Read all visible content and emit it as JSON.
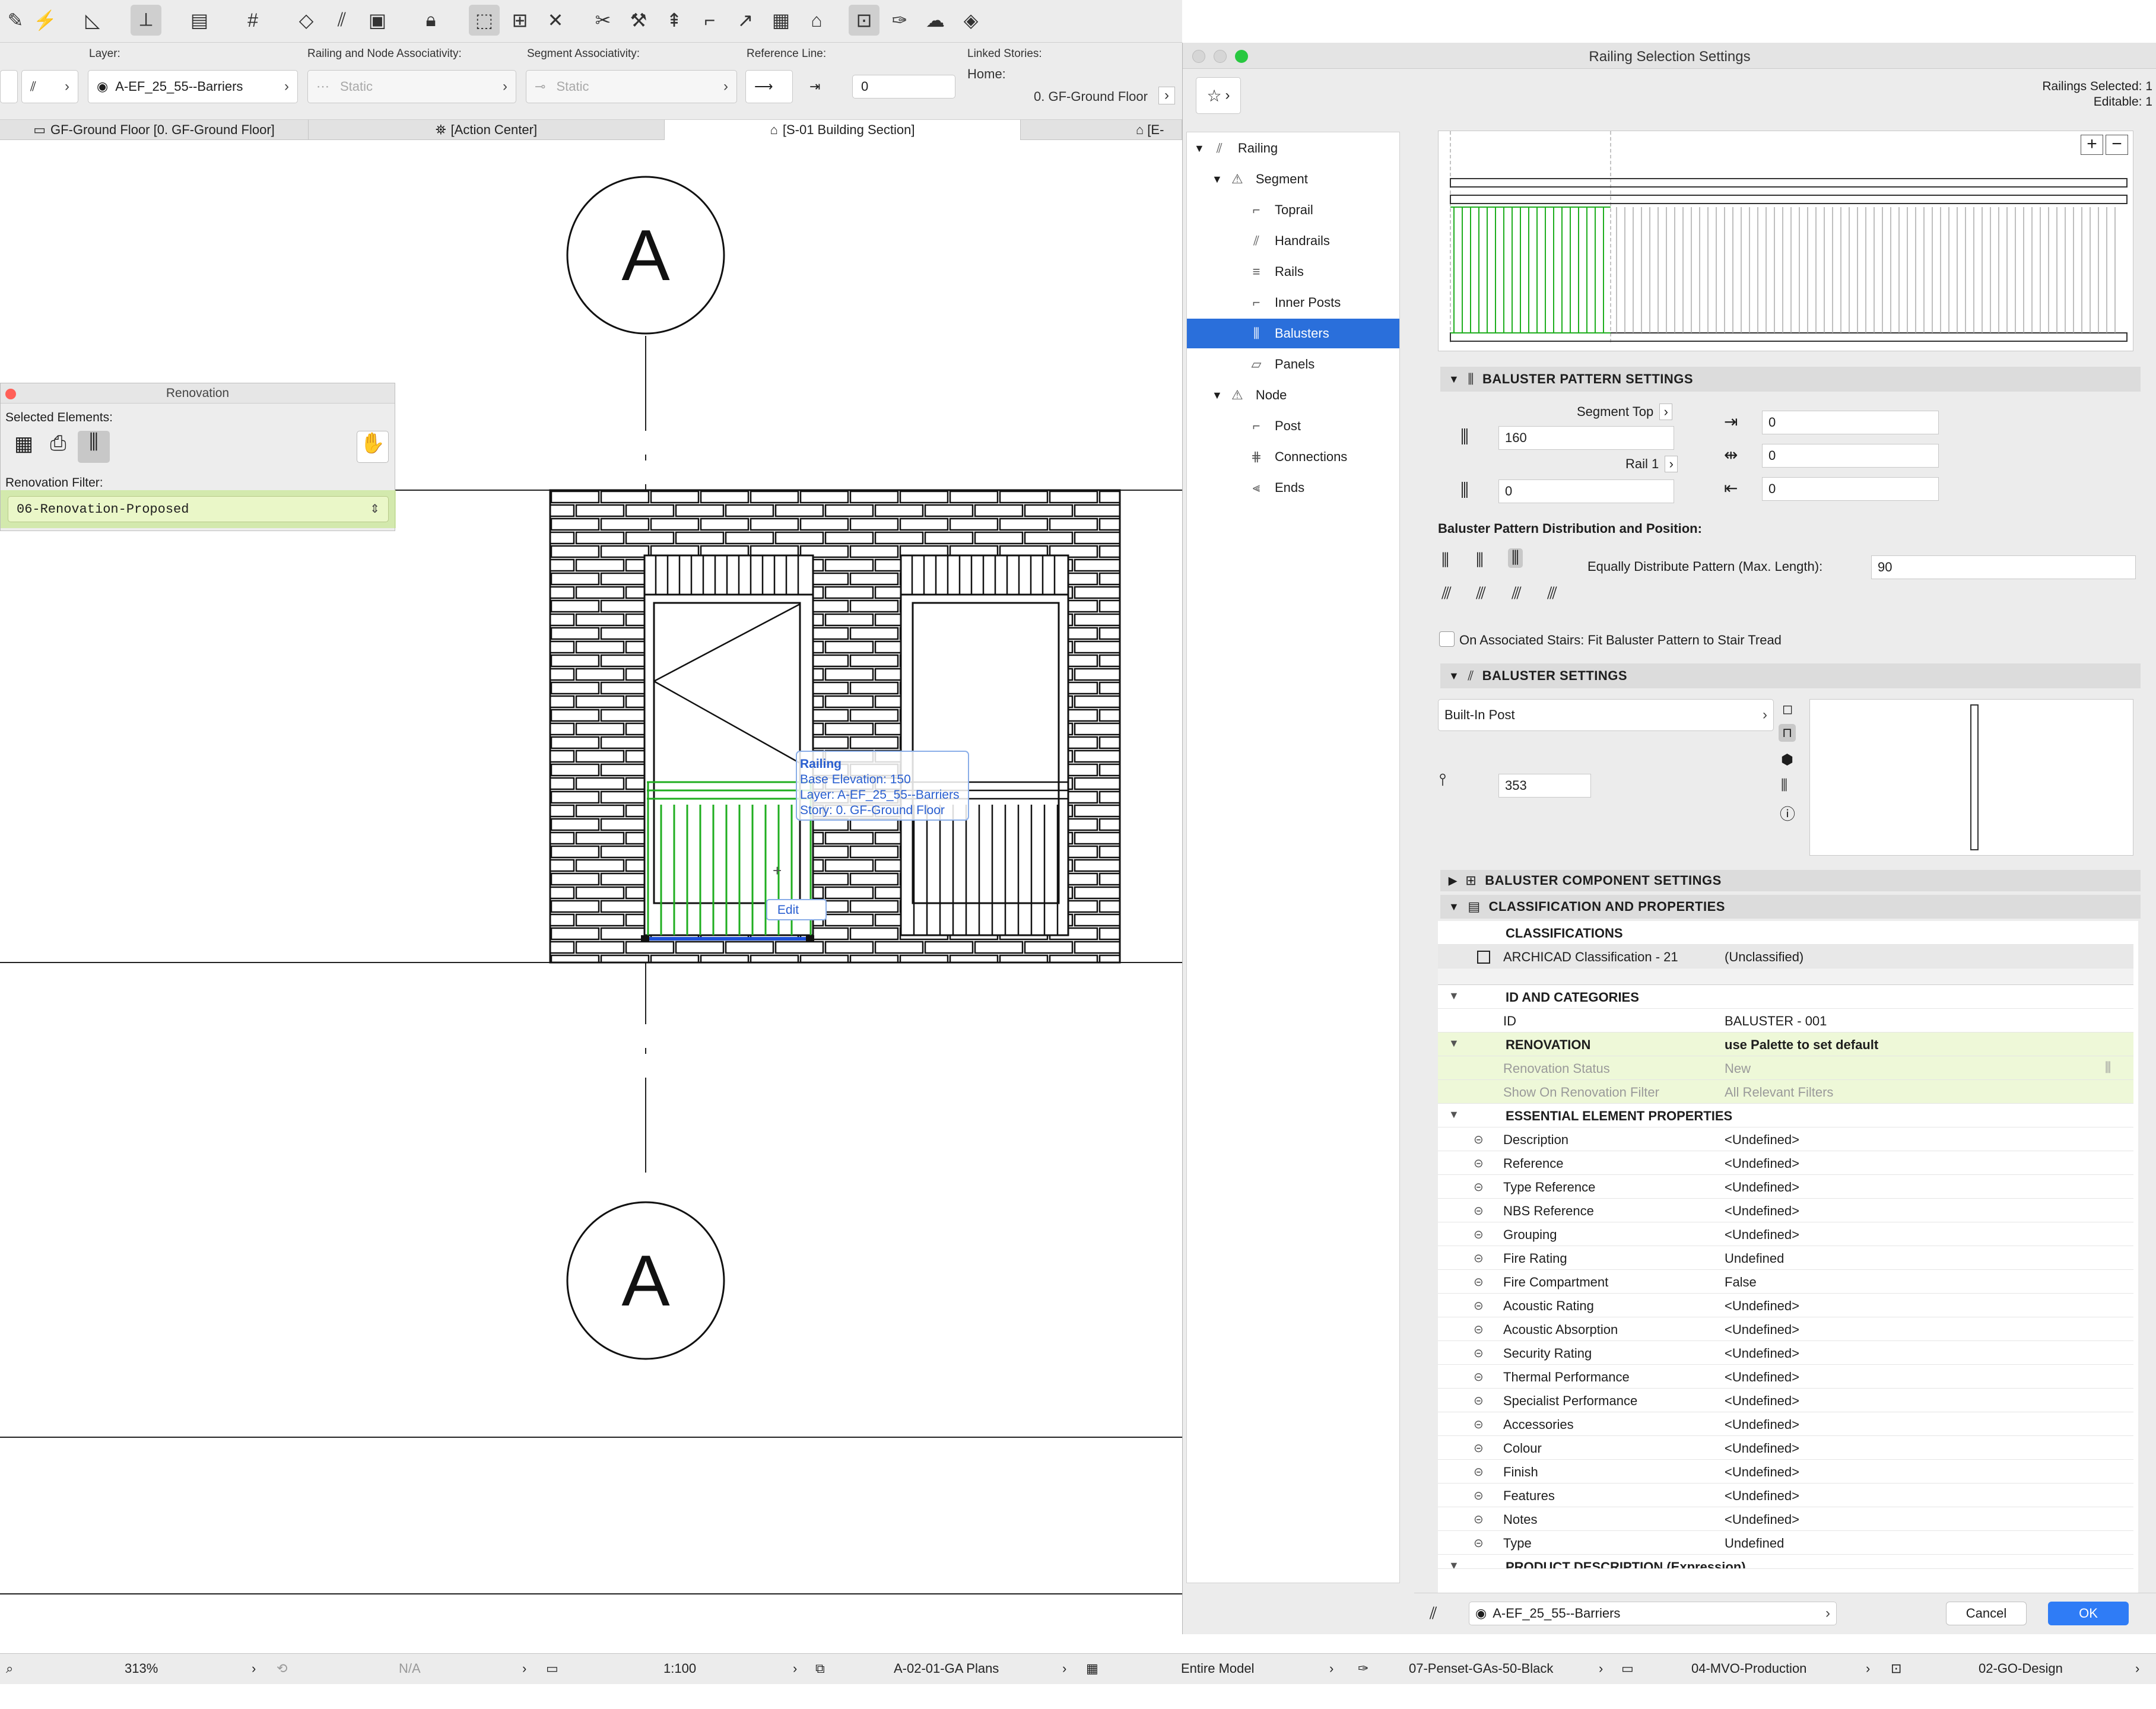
{
  "toolbar": {
    "icons": [
      "pencil-icon",
      "magic-wand-icon",
      "measure-icon",
      "snap-icon",
      "guide-icon",
      "grid-icon",
      "eraser-icon",
      "railing-icon",
      "box-icon",
      "lock-icon",
      "select-icon",
      "dimension-icon",
      "cross-icon",
      "scissors-icon",
      "hammer-icon",
      "adjust-icon",
      "corner-icon",
      "curve-icon",
      "layer-icon",
      "house-icon",
      "selection-icon",
      "pen-icon",
      "cloud-icon",
      "eye-icon"
    ]
  },
  "infobox": {
    "layer_label": "Layer:",
    "layer_value": "A-EF_25_55--Barriers",
    "assoc_label": "Railing and Node Associativity:",
    "assoc_value": "Static",
    "segassoc_label": "Segment Associativity:",
    "segassoc_value": "Static",
    "refline_label": "Reference Line:",
    "refline_value": "0",
    "linked_label": "Linked Stories:",
    "home_label": "Home:",
    "home_value": "0. GF-Ground Floor"
  },
  "tabs": [
    {
      "label": "GF-Ground Floor [0. GF-Ground Floor]"
    },
    {
      "label": "[Action Center]"
    },
    {
      "label": "[S-01 Building Section]"
    },
    {
      "label": "[E-"
    }
  ],
  "drawing": {
    "marker_top": "A",
    "marker_bottom": "A",
    "tooltip": {
      "title": "Railing",
      "line1": "Base Elevation: 150",
      "line2": "Layer: A-EF_25_55--Barriers",
      "line3": "Story: 0. GF-Ground Floor"
    },
    "edit_label": "Edit"
  },
  "renovation_palette": {
    "title": "Renovation",
    "selected_label": "Selected Elements:",
    "filter_label": "Renovation Filter:",
    "filter_value": "06-Renovation-Proposed"
  },
  "dialog": {
    "title": "Railing Selection Settings",
    "selected_count": "Railings Selected: 1",
    "editable_count": "Editable: 1",
    "tree": [
      {
        "label": "Railing",
        "level": 0
      },
      {
        "label": "Segment",
        "level": 1
      },
      {
        "label": "Toprail",
        "level": 2
      },
      {
        "label": "Handrails",
        "level": 2
      },
      {
        "label": "Rails",
        "level": 2
      },
      {
        "label": "Inner Posts",
        "level": 2
      },
      {
        "label": "Balusters",
        "level": 2
      },
      {
        "label": "Panels",
        "level": 2
      },
      {
        "label": "Node",
        "level": 1
      },
      {
        "label": "Post",
        "level": 2
      },
      {
        "label": "Connections",
        "level": 2
      },
      {
        "label": "Ends",
        "level": 2
      }
    ],
    "selected_tree_item": "Balusters",
    "pattern_header": "BALUSTER PATTERN SETTINGS",
    "segment_top_label": "Segment Top",
    "segment_top_value": "160",
    "rail1_label": "Rail 1",
    "rail1_value": "0",
    "right_values": [
      "0",
      "0",
      "0"
    ],
    "distribution_label": "Baluster Pattern Distribution and Position:",
    "equally_label": "Equally Distribute Pattern (Max. Length):",
    "equally_value": "90",
    "stairs_label": "On Associated Stairs: Fit Baluster Pattern to Stair Tread",
    "baluster_header": "BALUSTER SETTINGS",
    "baluster_type": "Built-In Post",
    "baluster_height": "353",
    "component_header": "BALUSTER COMPONENT SETTINGS",
    "classification_header": "CLASSIFICATION AND PROPERTIES",
    "classifications_label": "CLASSIFICATIONS",
    "class_name": "ARCHICAD Classification - 21",
    "class_value": "(Unclassified)",
    "id_cat_label": "ID AND CATEGORIES",
    "id_label": "ID",
    "id_value": "BALUSTER - 001",
    "renovation_label": "RENOVATION",
    "renovation_value": "use Palette to set default",
    "reno_status_label": "Renovation Status",
    "reno_status_value": "New",
    "reno_filter_label": "Show On Renovation Filter",
    "reno_filter_value": "All Relevant Filters",
    "essential_label": "ESSENTIAL ELEMENT PROPERTIES",
    "properties": [
      {
        "name": "Description",
        "value": "<Undefined>"
      },
      {
        "name": "Reference",
        "value": "<Undefined>"
      },
      {
        "name": "Type Reference",
        "value": "<Undefined>"
      },
      {
        "name": "NBS Reference",
        "value": "<Undefined>"
      },
      {
        "name": "Grouping",
        "value": "<Undefined>"
      },
      {
        "name": "Fire Rating",
        "value": "Undefined"
      },
      {
        "name": "Fire Compartment",
        "value": "False"
      },
      {
        "name": "Acoustic Rating",
        "value": "<Undefined>"
      },
      {
        "name": "Acoustic Absorption",
        "value": "<Undefined>"
      },
      {
        "name": "Security Rating",
        "value": "<Undefined>"
      },
      {
        "name": "Thermal Performance",
        "value": "<Undefined>"
      },
      {
        "name": "Specialist Performance",
        "value": "<Undefined>"
      },
      {
        "name": "Accessories",
        "value": "<Undefined>"
      },
      {
        "name": "Colour",
        "value": "<Undefined>"
      },
      {
        "name": "Finish",
        "value": "<Undefined>"
      },
      {
        "name": "Features",
        "value": "<Undefined>"
      },
      {
        "name": "Notes",
        "value": "<Undefined>"
      },
      {
        "name": "Type",
        "value": "Undefined"
      }
    ],
    "product_desc_label": "PRODUCT DESCRIPTION (Expression)",
    "footer_layer": "A-EF_25_55--Barriers",
    "cancel_label": "Cancel",
    "ok_label": "OK"
  },
  "status_bar": {
    "zoom": "313%",
    "na": "N/A",
    "scale": "1:100",
    "layer_combo": "A-02-01-GA Plans",
    "model_view": "Entire Model",
    "penset": "07-Penset-GAs-50-Black",
    "mvo": "04-MVO-Production",
    "design": "02-GO-Design"
  },
  "colors": {
    "selection_blue": "#2a6fdb",
    "highlight_green": "#bde678",
    "railing_green": "#1fae1f",
    "ok_blue": "#2f7cf6"
  }
}
